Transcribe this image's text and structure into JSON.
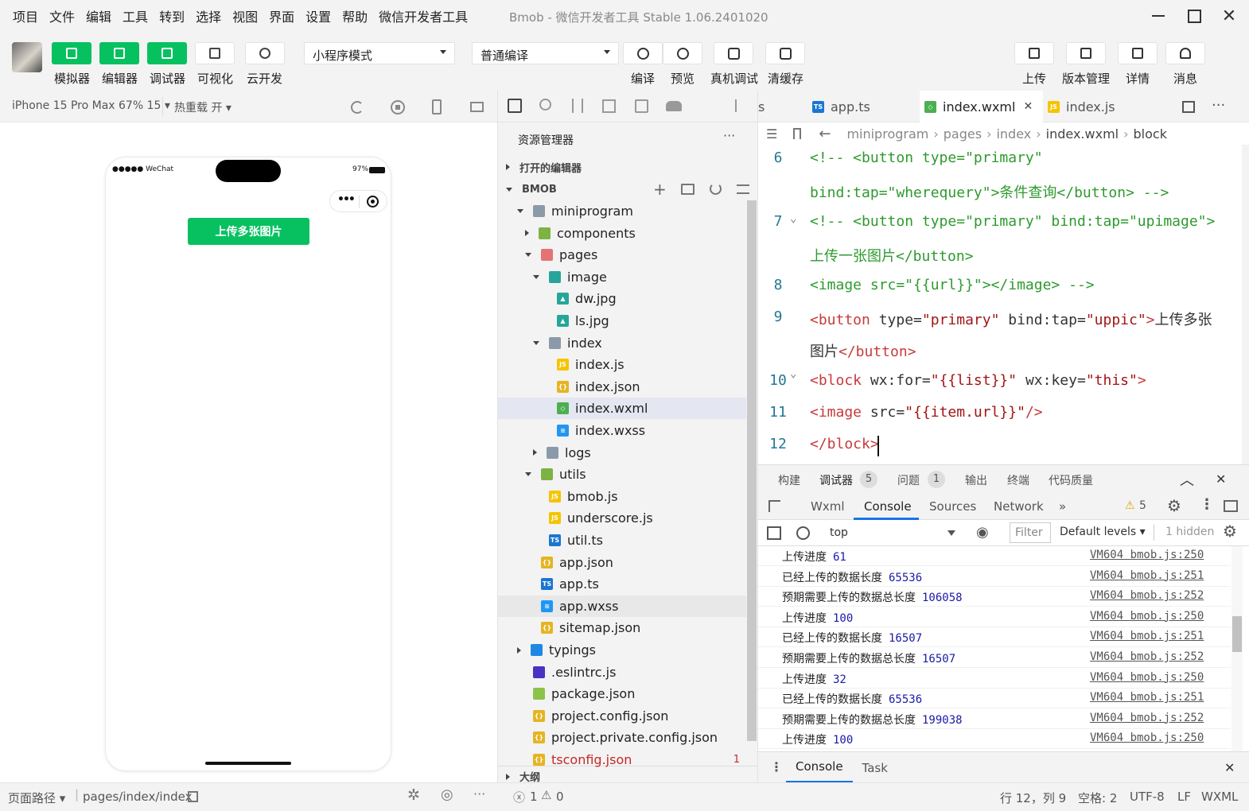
{
  "menubar": {
    "items": [
      "项目",
      "文件",
      "编辑",
      "工具",
      "转到",
      "选择",
      "视图",
      "界面",
      "设置",
      "帮助",
      "微信开发者工具"
    ],
    "window_title": "Bmob - 微信开发者工具 Stable 1.06.2401020"
  },
  "toolbar": {
    "left_buttons": [
      {
        "label": "模拟器",
        "icon": "phone-icon"
      },
      {
        "label": "编辑器",
        "icon": "code-icon"
      },
      {
        "label": "调试器",
        "icon": "debug-icon"
      },
      {
        "label": "可视化",
        "icon": "layout-icon"
      },
      {
        "label": "云开发",
        "icon": "cloud-icon"
      }
    ],
    "mode_select": "小程序模式",
    "compile_select": "普通编译",
    "mid_buttons": [
      {
        "label": "编译",
        "icon": "refresh-icon"
      },
      {
        "label": "预览",
        "icon": "eye-icon"
      },
      {
        "label": "真机调试",
        "icon": "bug-icon"
      },
      {
        "label": "清缓存",
        "icon": "layers-icon"
      }
    ],
    "right_buttons": [
      {
        "label": "上传",
        "icon": "upload-icon"
      },
      {
        "label": "版本管理",
        "icon": "branch-icon"
      },
      {
        "label": "详情",
        "icon": "menu-icon"
      },
      {
        "label": "消息",
        "icon": "bell-icon"
      }
    ]
  },
  "simulator": {
    "device": "iPhone 15 Pro Max 67% 15 ▾",
    "hot_reload": "热重载 开 ▾",
    "status_left": "●●●●● WeChat",
    "status_right": "97%",
    "upload_button": "上传多张图片"
  },
  "explorer": {
    "title": "资源管理器",
    "more": "···",
    "open_editors": "打开的编辑器",
    "project": "BMOB",
    "outline": "大纲",
    "tree": [
      {
        "name": "miniprogram",
        "type": "folder-open",
        "depth": 1,
        "arrow": "down"
      },
      {
        "name": "components",
        "type": "folder-green",
        "depth": 2,
        "arrow": "right"
      },
      {
        "name": "pages",
        "type": "folder-red",
        "depth": 2,
        "arrow": "down"
      },
      {
        "name": "image",
        "type": "folder-img",
        "depth": 3,
        "arrow": "down"
      },
      {
        "name": "dw.jpg",
        "type": "img",
        "depth": 4
      },
      {
        "name": "ls.jpg",
        "type": "img",
        "depth": 4
      },
      {
        "name": "index",
        "type": "folder-open",
        "depth": 3,
        "arrow": "down"
      },
      {
        "name": "index.js",
        "type": "js",
        "depth": 4
      },
      {
        "name": "index.json",
        "type": "json",
        "depth": 4
      },
      {
        "name": "index.wxml",
        "type": "wxml",
        "depth": 4,
        "selected": true
      },
      {
        "name": "index.wxss",
        "type": "wxss",
        "depth": 4
      },
      {
        "name": "logs",
        "type": "folder",
        "depth": 3,
        "arrow": "right"
      },
      {
        "name": "utils",
        "type": "folder-green",
        "depth": 2,
        "arrow": "down"
      },
      {
        "name": "bmob.js",
        "type": "js",
        "depth": 3
      },
      {
        "name": "underscore.js",
        "type": "js",
        "depth": 3
      },
      {
        "name": "util.ts",
        "type": "ts",
        "depth": 3
      },
      {
        "name": "app.json",
        "type": "json",
        "depth": 2
      },
      {
        "name": "app.ts",
        "type": "ts",
        "depth": 2
      },
      {
        "name": "app.wxss",
        "type": "wxss",
        "depth": 2,
        "hover": true
      },
      {
        "name": "sitemap.json",
        "type": "json",
        "depth": 2
      },
      {
        "name": "typings",
        "type": "folder-blue",
        "depth": 1,
        "arrow": "right"
      },
      {
        "name": ".eslintrc.js",
        "type": "eslint",
        "depth": 1
      },
      {
        "name": "package.json",
        "type": "node",
        "depth": 1
      },
      {
        "name": "project.config.json",
        "type": "json",
        "depth": 1
      },
      {
        "name": "project.private.config.json",
        "type": "json",
        "depth": 1
      },
      {
        "name": "tsconfig.json",
        "type": "json",
        "depth": 1,
        "error": "1"
      }
    ]
  },
  "editor": {
    "tabs": [
      {
        "label": "s",
        "icon": ""
      },
      {
        "label": "app.ts",
        "icon": "ts"
      },
      {
        "label": "index.wxml",
        "icon": "wxml",
        "active": true
      },
      {
        "label": "index.js",
        "icon": "js"
      }
    ],
    "breadcrumb": [
      "miniprogram",
      "pages",
      "index",
      "index.wxml",
      "block"
    ],
    "lines": [
      {
        "n": "6",
        "parts": [
          [
            "cm",
            "<!-- <button type=\"primary\""
          ]
        ]
      },
      {
        "n": "",
        "parts": [
          [
            "cm",
            "bind:tap=\"wherequery\">条件查询</button> -->"
          ]
        ]
      },
      {
        "n": "7",
        "parts": [
          [
            "cm",
            "<!-- <button type=\"primary\" bind:tap=\"upimage\">"
          ]
        ]
      },
      {
        "n": "",
        "parts": [
          [
            "cm",
            "上传一张图片</button>"
          ]
        ]
      },
      {
        "n": "8",
        "parts": [
          [
            "cm",
            "<image src=\"{{url}}\"></image> -->"
          ]
        ]
      },
      {
        "n": "9",
        "parts": [
          [
            "tg",
            "<button"
          ],
          [
            "at",
            " type="
          ],
          [
            "st",
            "\"primary\""
          ],
          [
            "at",
            " bind:tap="
          ],
          [
            "st",
            "\"uppic\""
          ],
          [
            "tg",
            ">"
          ],
          [
            "at",
            "上传多张"
          ]
        ]
      },
      {
        "n": "",
        "parts": [
          [
            "at",
            "图片"
          ],
          [
            "tg",
            "</button>"
          ]
        ]
      },
      {
        "n": "10",
        "parts": [
          [
            "tg",
            "<block"
          ],
          [
            "at",
            " wx:for="
          ],
          [
            "st",
            "\"{{list}}\""
          ],
          [
            "at",
            " wx:key="
          ],
          [
            "st",
            "\"this\""
          ],
          [
            "tg",
            ">"
          ]
        ]
      },
      {
        "n": "11",
        "parts": [
          [
            "tg",
            "<image"
          ],
          [
            "at",
            " src="
          ],
          [
            "st",
            "\"{{item.url}}\""
          ],
          [
            "tg",
            "/>"
          ]
        ]
      },
      {
        "n": "12",
        "parts": [
          [
            "tg",
            "</block>"
          ]
        ]
      }
    ]
  },
  "devtools": {
    "top_tabs": [
      "构建",
      "调试器",
      "问题",
      "输出",
      "终端",
      "代码质量"
    ],
    "debugger_badge": "5",
    "issues_badge": "1",
    "sub_tabs": [
      "Wxml",
      "Console",
      "Sources",
      "Network",
      "»"
    ],
    "warn_count": "5",
    "context": "top",
    "filter_placeholder": "Filter",
    "levels": "Default levels ▾",
    "hidden": "1 hidden",
    "console": [
      {
        "msg": "上传进度",
        "num": "61",
        "src": "VM604 bmob.js:250"
      },
      {
        "msg": "已经上传的数据长度",
        "num": "65536",
        "src": "VM604 bmob.js:251"
      },
      {
        "msg": "预期需要上传的数据总长度",
        "num": "106058",
        "src": "VM604 bmob.js:252"
      },
      {
        "msg": "上传进度",
        "num": "100",
        "src": "VM604 bmob.js:250"
      },
      {
        "msg": "已经上传的数据长度",
        "num": "16507",
        "src": "VM604 bmob.js:251"
      },
      {
        "msg": "预期需要上传的数据总长度",
        "num": "16507",
        "src": "VM604 bmob.js:252"
      },
      {
        "msg": "上传进度",
        "num": "32",
        "src": "VM604 bmob.js:250"
      },
      {
        "msg": "已经上传的数据长度",
        "num": "65536",
        "src": "VM604 bmob.js:251"
      },
      {
        "msg": "预期需要上传的数据总长度",
        "num": "199038",
        "src": "VM604 bmob.js:252"
      },
      {
        "msg": "上传进度",
        "num": "100",
        "src": "VM604 bmob.js:250"
      }
    ],
    "drawer_tabs": [
      "Console",
      "Task"
    ]
  },
  "statusbar": {
    "page_path_label": "页面路径 ▾",
    "page_path": "pages/index/index",
    "errors": "1",
    "warnings": "0",
    "position": "行 12，列 9",
    "indent": "空格: 2",
    "encoding": "UTF-8",
    "eol": "LF",
    "lang": "WXML"
  },
  "colors": {
    "accent": "#07c160",
    "link": "#0e639c"
  }
}
